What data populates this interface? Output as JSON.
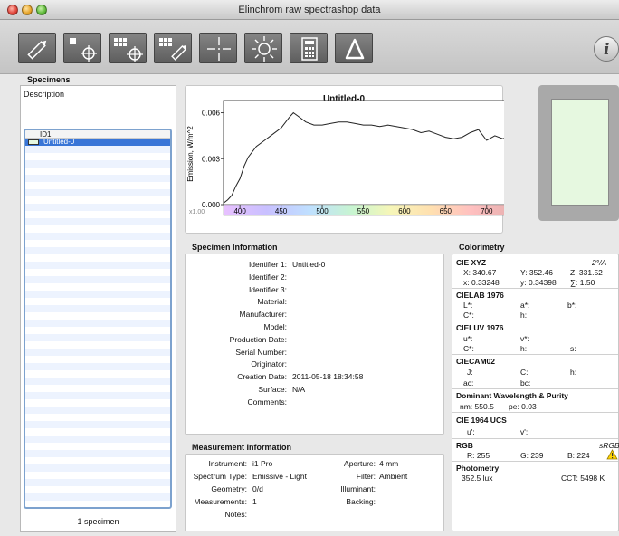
{
  "window": {
    "title": "Elinchrom raw spectrashop data"
  },
  "colors": {
    "specimen_color": "#e6f8e0",
    "selection": "#3875d7",
    "warning": "#ffd400"
  },
  "toolbar": {
    "buttons": [
      {
        "name": "edit-pencil-icon"
      },
      {
        "name": "measure-single-icon"
      },
      {
        "name": "measure-strip-icon"
      },
      {
        "name": "edit-strip-icon"
      },
      {
        "name": "crosshair-icon"
      },
      {
        "name": "illuminant-sun-icon"
      },
      {
        "name": "calculator-icon"
      },
      {
        "name": "delta-icon"
      }
    ],
    "info_glyph": "i"
  },
  "specimens": {
    "heading": "Specimens",
    "description_label": "Description",
    "column": "ID1",
    "rows": [
      "Untitled-0"
    ],
    "count_text": "1 specimen"
  },
  "chart_data": {
    "type": "line",
    "title": "Untitled-0",
    "xlabel": "",
    "ylabel": "Emission, W/m^2",
    "multiplier": "x1.00",
    "xlim": [
      380,
      730
    ],
    "ylim": [
      0,
      0.0068
    ],
    "x_ticks": [
      400,
      450,
      500,
      550,
      600,
      650,
      700,
      750
    ],
    "y_ticks": [
      "0.000",
      "0.003",
      "0.006"
    ],
    "x": [
      380,
      385,
      390,
      395,
      400,
      405,
      410,
      420,
      430,
      440,
      450,
      460,
      465,
      470,
      480,
      490,
      500,
      510,
      520,
      530,
      540,
      550,
      560,
      570,
      580,
      590,
      600,
      610,
      620,
      630,
      640,
      650,
      660,
      670,
      680,
      690,
      700,
      710,
      720,
      730
    ],
    "values": [
      0.0001,
      0.0003,
      0.0006,
      0.0012,
      0.0017,
      0.0025,
      0.0031,
      0.0038,
      0.0042,
      0.0046,
      0.005,
      0.0057,
      0.006,
      0.0058,
      0.0054,
      0.0052,
      0.0052,
      0.0053,
      0.0054,
      0.0054,
      0.0053,
      0.0052,
      0.0052,
      0.0051,
      0.0052,
      0.0051,
      0.005,
      0.0049,
      0.0047,
      0.0048,
      0.0046,
      0.0044,
      0.0043,
      0.0044,
      0.0047,
      0.0049,
      0.0042,
      0.0045,
      0.0043,
      0.0046
    ]
  },
  "specimen_info": {
    "title": "Specimen Information",
    "fields": [
      {
        "label": "Identifier 1:",
        "value": "Untitled-0"
      },
      {
        "label": "Identifier 2:",
        "value": ""
      },
      {
        "label": "Identifier 3:",
        "value": ""
      },
      {
        "label": "Material:",
        "value": ""
      },
      {
        "label": "Manufacturer:",
        "value": ""
      },
      {
        "label": "Model:",
        "value": ""
      },
      {
        "label": "Production Date:",
        "value": ""
      },
      {
        "label": "Serial Number:",
        "value": ""
      },
      {
        "label": "Originator:",
        "value": ""
      },
      {
        "label": "Creation Date:",
        "value": "2011-05-18 18:34:58"
      },
      {
        "label": "Surface:",
        "value": "N/A"
      },
      {
        "label": "Comments:",
        "value": ""
      }
    ]
  },
  "measurement_info": {
    "title": "Measurement Information",
    "left": [
      {
        "label": "Instrument:",
        "value": "i1 Pro"
      },
      {
        "label": "Spectrum Type:",
        "value": "Emissive - Light"
      },
      {
        "label": "Geometry:",
        "value": "0/d"
      },
      {
        "label": "Measurements:",
        "value": "1"
      },
      {
        "label": "Notes:",
        "value": ""
      }
    ],
    "right": [
      {
        "label": "Aperture:",
        "value": "4 mm"
      },
      {
        "label": "Filter:",
        "value": "Ambient"
      },
      {
        "label": "Illuminant:",
        "value": ""
      },
      {
        "label": "Backing:",
        "value": ""
      }
    ]
  },
  "colorimetry": {
    "title": "Colorimetry",
    "cie_xyz": {
      "head": "CIE XYZ",
      "observer": "2°/A",
      "X": "X: 340.67",
      "Y": "Y: 352.46",
      "Z": "Z: 331.52",
      "x": "x: 0.33248",
      "y": "y: 0.34398",
      "sum": "∑: 1.50"
    },
    "cielab": {
      "head": "CIELAB 1976",
      "L": "L*:",
      "a": "a*:",
      "b": "b*:",
      "C": "C*:",
      "h": "h:"
    },
    "cieluv": {
      "head": "CIELUV 1976",
      "u": "u*:",
      "v": "v*:",
      "C": "C*:",
      "h": "h:",
      "s": "s:"
    },
    "ciecam": {
      "head": "CIECAM02",
      "J": "J:",
      "C": "C:",
      "h": "h:",
      "ac": "ac:",
      "bc": "bc:"
    },
    "dominant": {
      "head": "Dominant Wavelength & Purity",
      "nm": "nm: 550.5",
      "pe": "pe: 0.03"
    },
    "ucs": {
      "head": "CIE 1964 UCS",
      "u": "u':",
      "v": "v':"
    },
    "rgb": {
      "head": "RGB",
      "space": "sRGB",
      "R": "R: 255",
      "G": "G: 239",
      "B": "B: 224"
    },
    "photometry": {
      "head": "Photometry",
      "lux": "352.5 lux",
      "cct": "CCT: 5498 K"
    }
  }
}
